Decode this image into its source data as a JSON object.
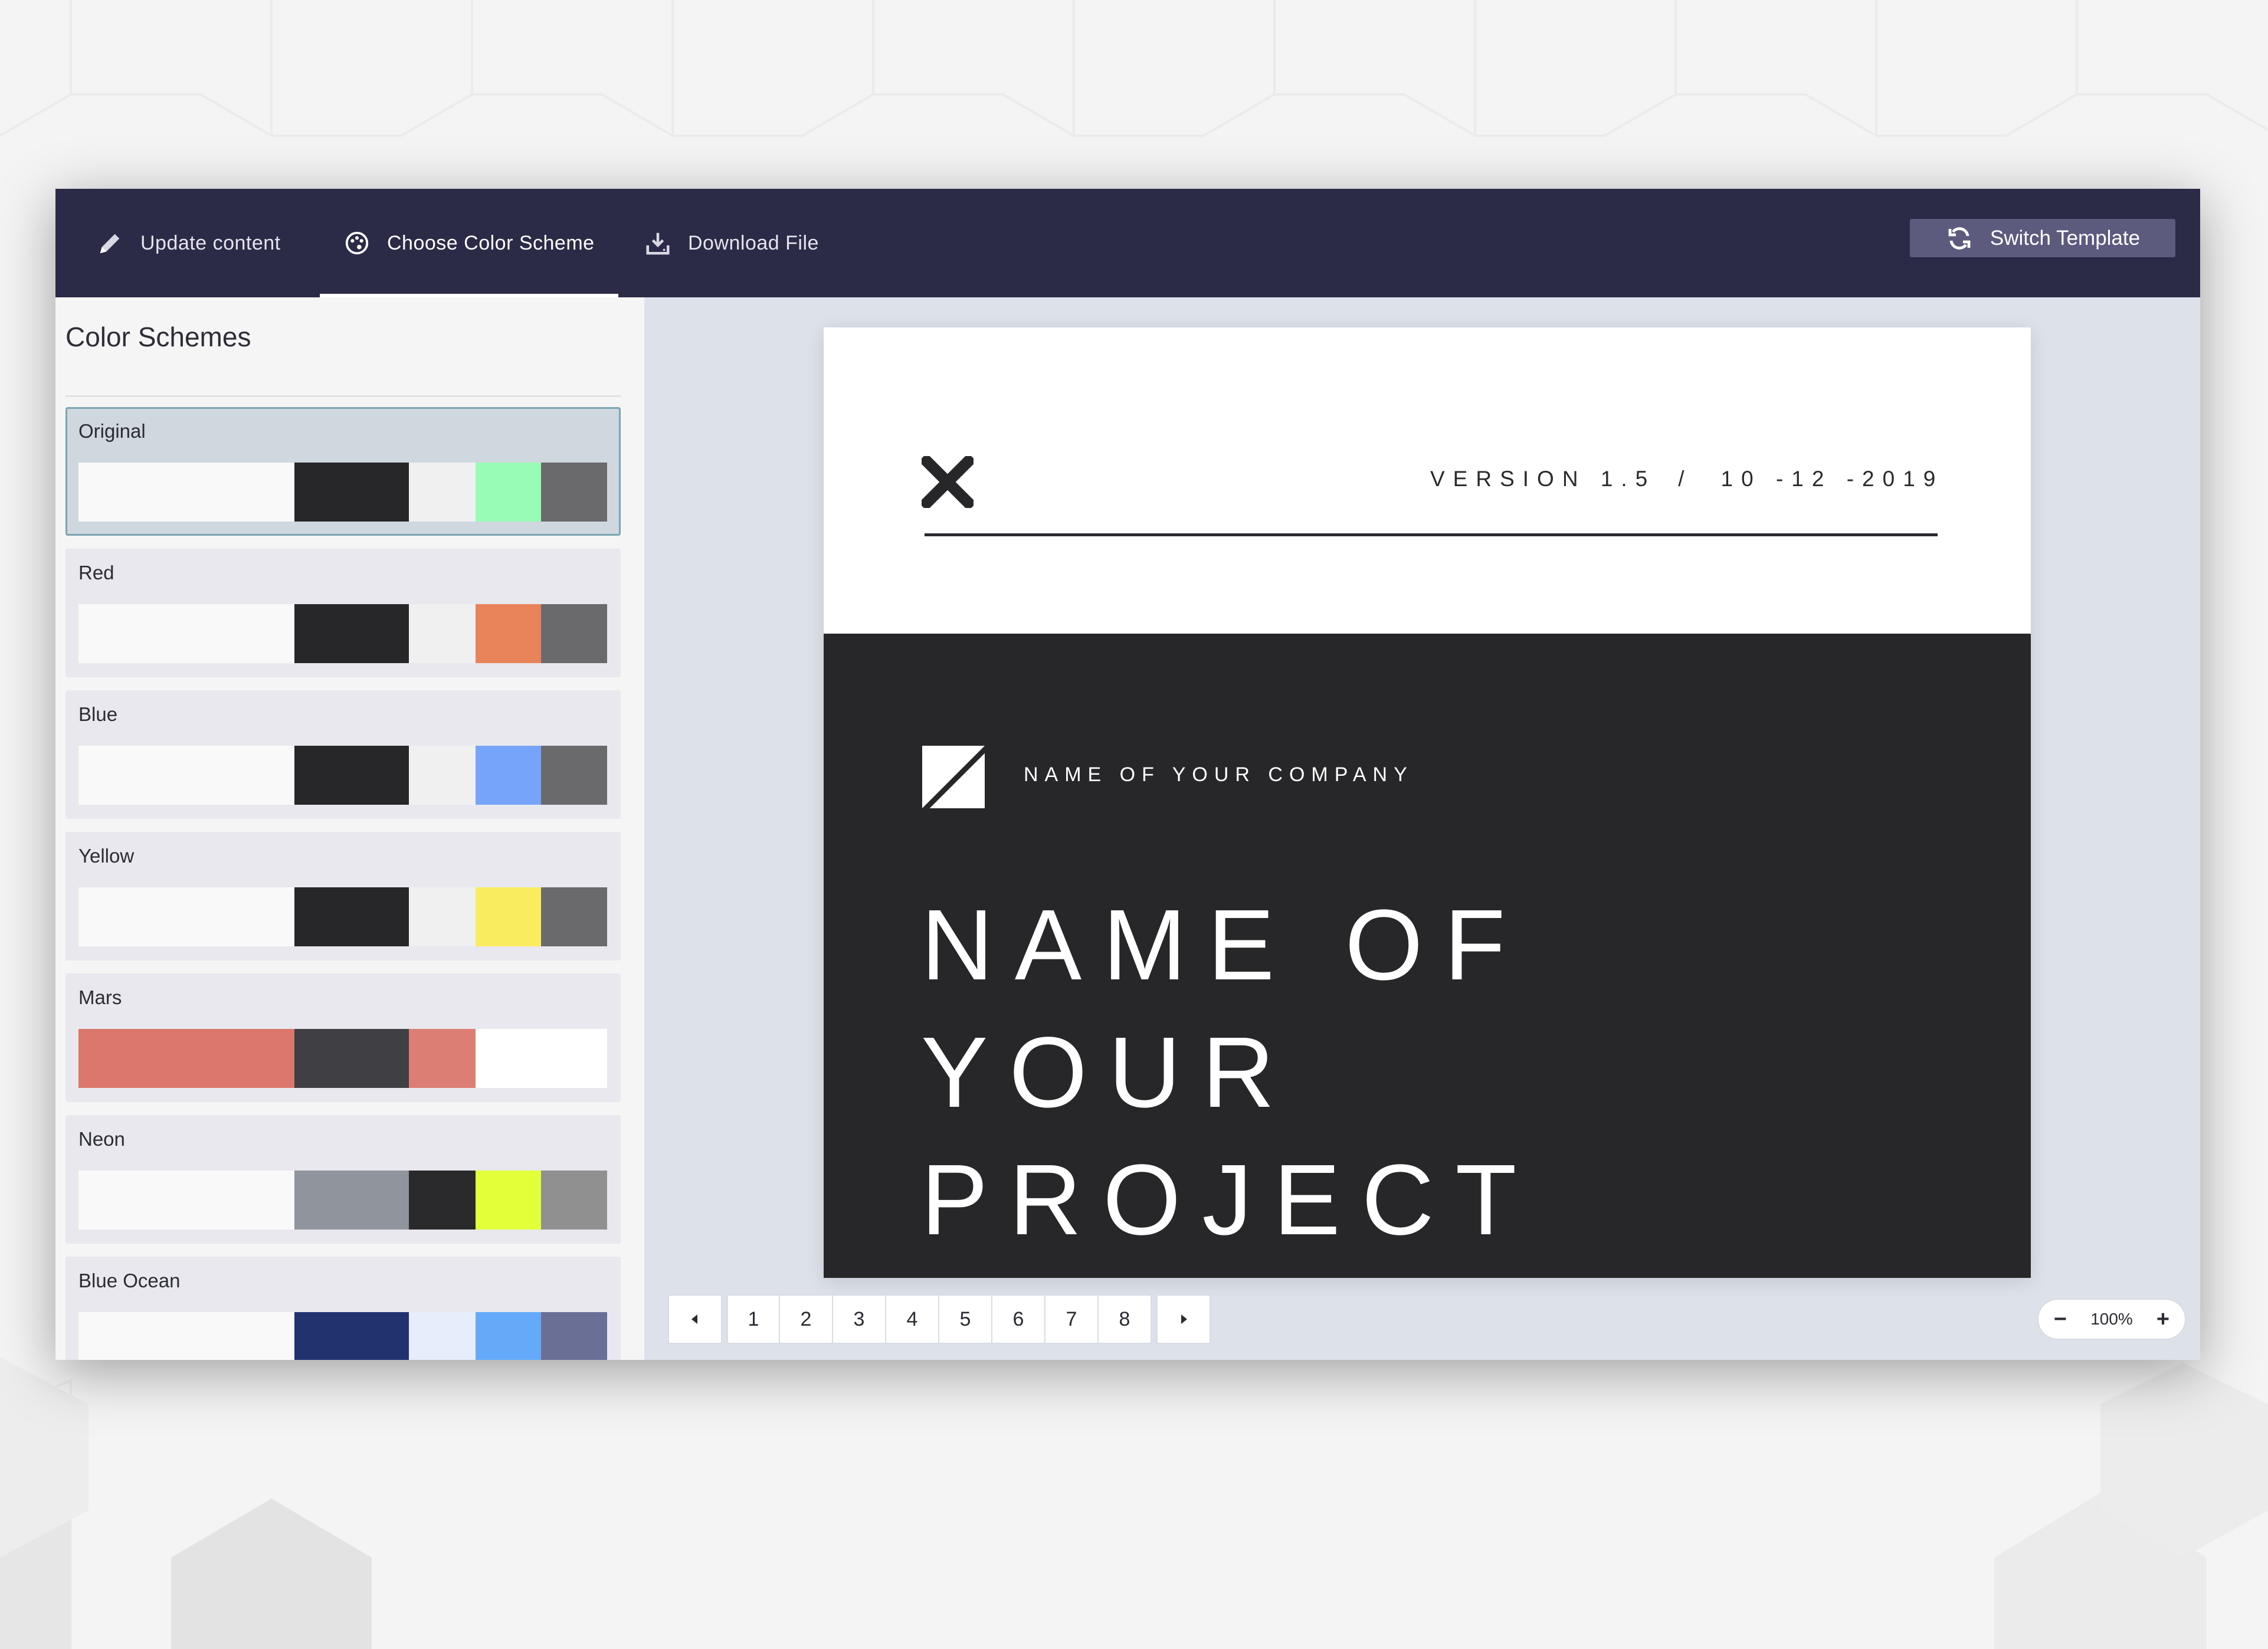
{
  "topbar": {
    "tabs": [
      {
        "label": "Update content",
        "icon": "pencil-icon"
      },
      {
        "label": "Choose Color Scheme",
        "icon": "palette-icon",
        "active": true
      },
      {
        "label": "Download File",
        "icon": "download-icon"
      }
    ],
    "switch_template_label": "Switch Template"
  },
  "sidebar": {
    "title": "Color Schemes",
    "schemes": [
      {
        "name": "Original",
        "selected": true,
        "colors": [
          "#f9f9f9",
          "#27272a",
          "#f0f0f0",
          "#98fbb6",
          "#6a6a6d"
        ]
      },
      {
        "name": "Red",
        "colors": [
          "#f9f9f9",
          "#27272a",
          "#f0f0f0",
          "#e8835a",
          "#6a6a6d"
        ]
      },
      {
        "name": "Blue",
        "colors": [
          "#f9f9f9",
          "#27272a",
          "#f0f0f0",
          "#76a4fb",
          "#6a6a6d"
        ]
      },
      {
        "name": "Yellow",
        "colors": [
          "#f9f9f9",
          "#27272a",
          "#f0f0f0",
          "#f9ed5f",
          "#6a6a6d"
        ]
      },
      {
        "name": "Mars",
        "colors": [
          "#dc776c",
          "#3f3f44",
          "#dc7e74",
          "#ffffff",
          "#ffffff"
        ]
      },
      {
        "name": "Neon",
        "colors": [
          "#f9f9f9",
          "#8f949d",
          "#2a2a2d",
          "#e2ff3a",
          "#909090"
        ]
      },
      {
        "name": "Blue Ocean",
        "colors": [
          "#f9f9f9",
          "#21326f",
          "#e7eefb",
          "#64aaf9",
          "#6a6f96"
        ]
      }
    ]
  },
  "slide": {
    "version_text": "VERSION 1.5",
    "separator": "/",
    "date_text": "10 -12 -2019",
    "company": "NAME OF YOUR COMPANY",
    "project_line1": "NAME OF YOUR",
    "project_line2": "PROJECT"
  },
  "pager": {
    "pages": [
      "1",
      "2",
      "3",
      "4",
      "5",
      "6",
      "7",
      "8"
    ],
    "prev_icon": "caret-left-icon",
    "next_icon": "caret-right-icon"
  },
  "zoom": {
    "minus": "−",
    "value": "100%",
    "plus": "+"
  }
}
